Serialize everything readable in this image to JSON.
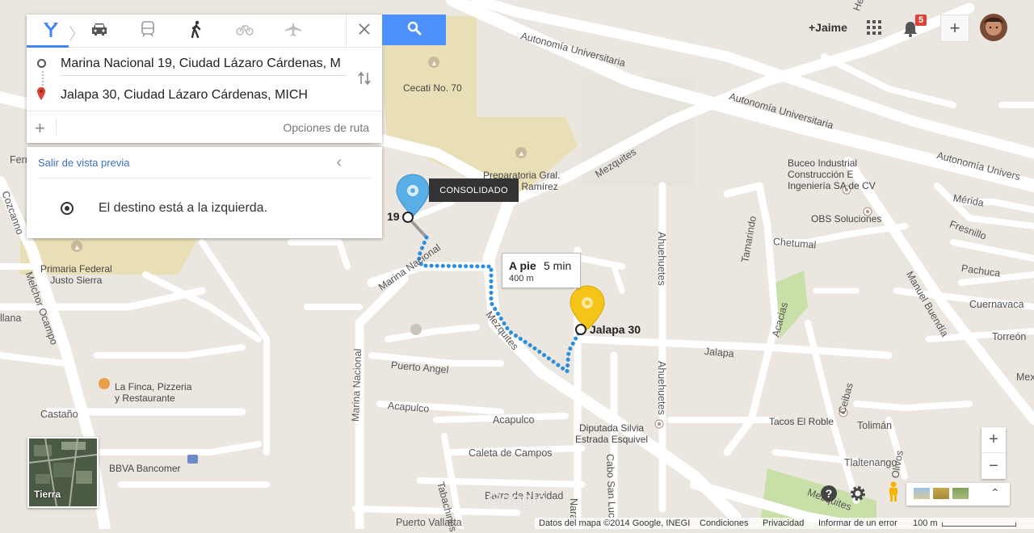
{
  "search": {
    "modes": [
      "directions-icon",
      "car-icon",
      "transit-icon",
      "walk-icon",
      "bike-icon",
      "flight-icon"
    ],
    "origin": "Marina Nacional 19, Ciudad Lázaro Cárdenas, M",
    "destination": "Jalapa 30, Ciudad Lázaro Cárdenas, MICH",
    "route_options": "Opciones de ruta"
  },
  "preview": {
    "exit_label": "Salir de vista previa",
    "step_text": "El destino está a la izquierda."
  },
  "account": {
    "name": "+Jaime",
    "notifications": "5"
  },
  "route": {
    "mode": "A pie",
    "time": "5 min",
    "distance": "400 m",
    "start_label": "19",
    "end_label": "Jalapa 30",
    "tag": "CONSOLIDADO"
  },
  "map_labels": {
    "roads": [
      "Autonomía Universitaria",
      "Autonomía Universitaria",
      "Autonomía Univers",
      "Mezquites",
      "Marina Nacional",
      "Marina Nacional",
      "Mezquites",
      "Melchor Ocampo",
      "Ahuehuetes",
      "Ahuehuetes",
      "Tamarindo",
      "Acacias",
      "Manuel Buendía",
      "Jalapa",
      "Puerto Angel",
      "Acapulco",
      "Acapulco",
      "Caleta de Campos",
      "Barra de Navidad",
      "Puerto Vallarta",
      "Tabachines",
      "Cabo San Luc",
      "Nara",
      "Chetumal",
      "Pachuca",
      "Cuernavaca",
      "Torreón",
      "Mérida",
      "Fresnillo",
      "Tolimán",
      "Tlaltenango",
      "Ceibas",
      "Olivos",
      "Mezquites",
      "Castaño",
      "Ferr",
      "llana",
      "Helecho",
      "Cozcanno",
      "Mex"
    ],
    "pois": [
      "Cecati No. 70",
      "Preparatoria Gral. Enrique Ramírez",
      "Buceo Industrial Construcción E Ingeniería SA de CV",
      "OBS Soluciones",
      "Primaria Federal Justo Sierra",
      "La Finca, Pizzeria y Restaurante",
      "BBVA Bancomer",
      "Diputada Silvia Estrada Esquivel",
      "Tacos El Roble"
    ]
  },
  "map_ui": {
    "earth_label": "Tierra",
    "zoom_in": "+",
    "zoom_out": "−",
    "watermark": "Google"
  },
  "footer": {
    "data": "Datos del mapa ©2014 Google, INEGI",
    "terms": "Condiciones",
    "privacy": "Privacidad",
    "report": "Informar de un error",
    "scale": "100 m"
  },
  "colors": {
    "route_blue": "#2a8fe0",
    "route_gray": "#999999",
    "pin_blue": "#5aaee6",
    "pin_yellow": "#f5c418",
    "accent": "#4d90fe"
  }
}
